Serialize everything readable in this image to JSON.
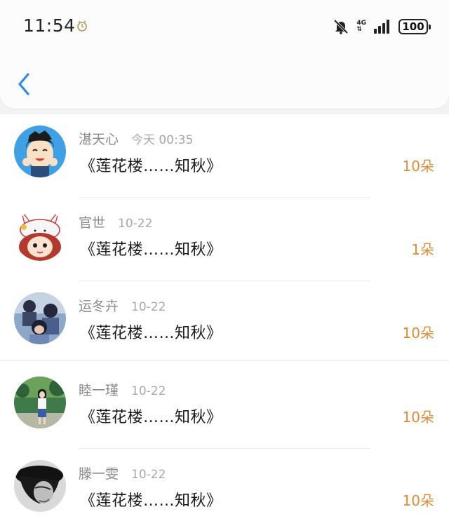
{
  "status_bar": {
    "time": "11:54",
    "network": "4G",
    "battery": "100",
    "icons": [
      "alarm-icon",
      "mute-bell-icon",
      "signal-icon",
      "battery-icon"
    ]
  },
  "header": {
    "back_icon": "chevron-left-icon",
    "accent_color": "#2a8de0"
  },
  "list": {
    "items": [
      {
        "name": "湛天心",
        "date": "今天 00:35",
        "title": "《莲花楼……知秋》",
        "flowers": "10朵"
      },
      {
        "name": "官世",
        "date": "10-22",
        "title": "《莲花楼……知秋》",
        "flowers": "1朵"
      },
      {
        "name": "运冬卉",
        "date": "10-22",
        "title": "《莲花楼……知秋》",
        "flowers": "10朵"
      },
      {
        "name": "睦一瑾",
        "date": "10-22",
        "title": "《莲花楼……知秋》",
        "flowers": "10朵"
      },
      {
        "name": "滕一雯",
        "date": "10-22",
        "title": "《莲花楼……知秋》",
        "flowers": "10朵"
      }
    ],
    "flower_color": "#e58a33"
  }
}
